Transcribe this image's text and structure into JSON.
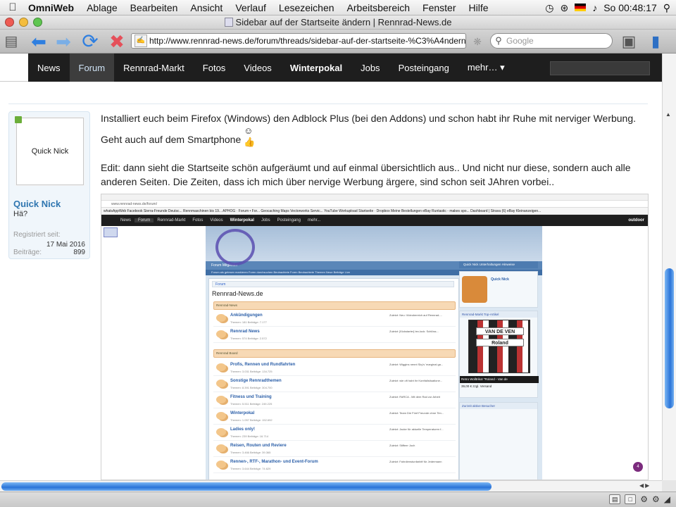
{
  "menubar": {
    "app_name": "OmniWeb",
    "items": [
      "Ablage",
      "Bearbeiten",
      "Ansicht",
      "Verlauf",
      "Lesezeichen",
      "Arbeitsbereich",
      "Fenster",
      "Hilfe"
    ],
    "clock": "So 00:48:17"
  },
  "window": {
    "title": "Sidebar auf der Startseite ändern | Rennrad-News.de"
  },
  "toolbar": {
    "url": "http://www.rennrad-news.de/forum/threads/sidebar-auf-der-startseite-%C3%A4ndern.1",
    "search_placeholder": "Google"
  },
  "site_nav": {
    "items": [
      "News",
      "Forum",
      "Rennrad-Markt",
      "Fotos",
      "Videos",
      "Winterpokal",
      "Jobs",
      "Posteingang",
      "mehr… ▾"
    ]
  },
  "user": {
    "avatar_text": "Quick Nick",
    "name": "Quick Nick",
    "title": "Hä?",
    "registered_label": "Registriert seit:",
    "registered_value": "17 Mai 2016",
    "posts_label": "Beiträge:",
    "posts_value": "899"
  },
  "post": {
    "paragraph1": "Installiert euch beim Firefox (Windows) den Adblock Plus (bei den Addons) und schon habt ihr Ruhe mit nerviger Werbung. Geht auch auf dem Smartphone",
    "paragraph2": "Edit: dann sieht die Startseite schön aufgeräumt und auf einmal übersichtlich aus.. Und nicht nur diese, sondern auch alle anderen Seiten. Die Zeiten, dass ich mich über nervige Werbung ärgere, sind schon seit JAhren vorbei.."
  },
  "embedded": {
    "url": "www.rennrad-news.de/forum/",
    "bookmarks": "whatsAppWeb   Facebook   Sierra-Freunde Deutsc...   Rennmaschinen bis 19...   APHOG · Forum • For...   Geocaching Maps   Vectorworks Servic...   YouTube   Workupload   Startseite · Dropbox   Meine Bestellungen   eBay   Runtastic - makes spo...   Dashboard | Strava   (6) eBay Kleinanzeigen...",
    "nav": [
      "News",
      "Forum",
      "Rennrad-Markt",
      "Fotos",
      "Videos",
      "Winterpokal",
      "Jobs",
      "Posteingang",
      "mehr..."
    ],
    "brand": "outdoor",
    "tabs": "Forum    Mitglieder",
    "subnav": "Forum als gelesen markieren    Foren durchsuchen    Beobachtete Foren    Beobachtete Themen    Neue Beiträge    Live",
    "right_tabs": "Quick Nick    Unterhaltungen    Hinweise",
    "crumb": "Forum",
    "title": "Rennrad-News.de",
    "cat1": "Rennrad-News",
    "cat2": "Rennrad Board",
    "forums": [
      {
        "name": "Ankündigungen",
        "stats": "Themen: 181  Beiträge: 7.177",
        "last": "Zuletzt: Neu: Videobereich auf Rennrad-..."
      },
      {
        "name": "Rennrad News",
        "stats": "Themen: 574  Beiträge: 2.572",
        "last": "Zuletzt: [Kickstarter] tex-lock: Schlöss..."
      },
      {
        "name": "Profis, Rennen und Rundfahrten",
        "stats": "Themen: 3.031  Beiträge: 134.725",
        "last": "Zuletzt: Wiggins nennt Sky's 'marginal ga..."
      },
      {
        "name": "Sonstige Rennradthemen",
        "stats": "Themen: 8.391  Beiträge: 304.700",
        "last": "Zuletzt: wie oft habt ihr Kontfallsituatione..."
      },
      {
        "name": "Fitness und Training",
        "stats": "Themen: 5.511  Beiträge: 249.225",
        "last": "Zuletzt: RdRCA - Mit dem Rad zur Arbeit"
      },
      {
        "name": "Winterpokal",
        "stats": "Themen: 1.057  Beiträge: 152.692",
        "last": "Zuletzt: Team Die Fünf Freunde ohne Tim..."
      },
      {
        "name": "Ladies only!",
        "stats": "Themen: 239  Beiträge: 16.714",
        "last": "Zuletzt: Jacke für aktuelle Temperaturen f..."
      },
      {
        "name": "Reisen, Routen und Reviere",
        "stats": "Themen: 3.466  Beiträge: 39.365",
        "last": "Zuletzt: Stiffeer Joch"
      },
      {
        "name": "Rennen-, RTF-, Marathon- und Event-Forum",
        "stats": "Themen: 3.644  Beiträge: 74.629",
        "last": "Zuletzt: Fahrdienstunfarbitf für Jedermann"
      }
    ],
    "profile_name": "Quick Nick",
    "market_title": "Rennrad-Markt Top-Artikel",
    "jersey_top": "VAN DE VEN",
    "jersey_mid": "Roland",
    "item_title": "Retro Wolltrikot \"Roland - Van de",
    "item_price": "39,00 € zzgl. Versand",
    "visitors_title": "Zurzeit aktive Besucher",
    "notif": "4"
  }
}
